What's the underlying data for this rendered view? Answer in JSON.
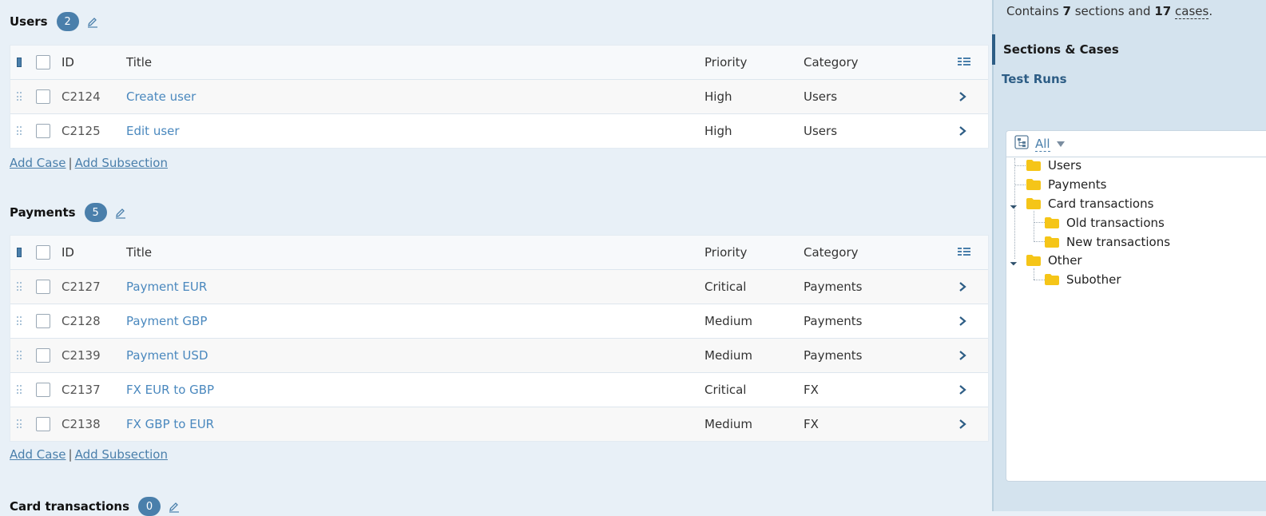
{
  "sections": [
    {
      "name": "Users",
      "count": "2",
      "columns": {
        "id": "ID",
        "title": "Title",
        "priority": "Priority",
        "category": "Category"
      },
      "rows": [
        {
          "id": "C2124",
          "title": "Create user",
          "priority": "High",
          "category": "Users"
        },
        {
          "id": "C2125",
          "title": "Edit user",
          "priority": "High",
          "category": "Users"
        }
      ],
      "add_case": "Add Case",
      "add_subsection": "Add Subsection",
      "separator": "|"
    },
    {
      "name": "Payments",
      "count": "5",
      "columns": {
        "id": "ID",
        "title": "Title",
        "priority": "Priority",
        "category": "Category"
      },
      "rows": [
        {
          "id": "C2127",
          "title": "Payment EUR",
          "priority": "Critical",
          "category": "Payments"
        },
        {
          "id": "C2128",
          "title": "Payment GBP",
          "priority": "Medium",
          "category": "Payments"
        },
        {
          "id": "C2139",
          "title": "Payment USD",
          "priority": "Medium",
          "category": "Payments"
        },
        {
          "id": "C2137",
          "title": "FX EUR to GBP",
          "priority": "Critical",
          "category": "FX"
        },
        {
          "id": "C2138",
          "title": "FX GBP to EUR",
          "priority": "Medium",
          "category": "FX"
        }
      ],
      "add_case": "Add Case",
      "add_subsection": "Add Subsection",
      "separator": "|"
    },
    {
      "name": "Card transactions",
      "count": "0"
    }
  ],
  "sidebar": {
    "summary": {
      "prefix": "Contains",
      "sections_count": "7",
      "middle": "sections and",
      "cases_count": "17",
      "cases_word": "cases",
      "suffix": "."
    },
    "nav": {
      "active": "Sections & Cases",
      "test_runs": "Test Runs"
    },
    "filter_label": "All",
    "tree": [
      "Users",
      "Payments",
      "Card transactions",
      "Old transactions",
      "New transactions",
      "Other",
      "Subother"
    ]
  },
  "colors": {
    "accent": "#4a7fab",
    "link": "#4a88be",
    "folder": "#f5c518",
    "badge": "#4a7fab"
  }
}
